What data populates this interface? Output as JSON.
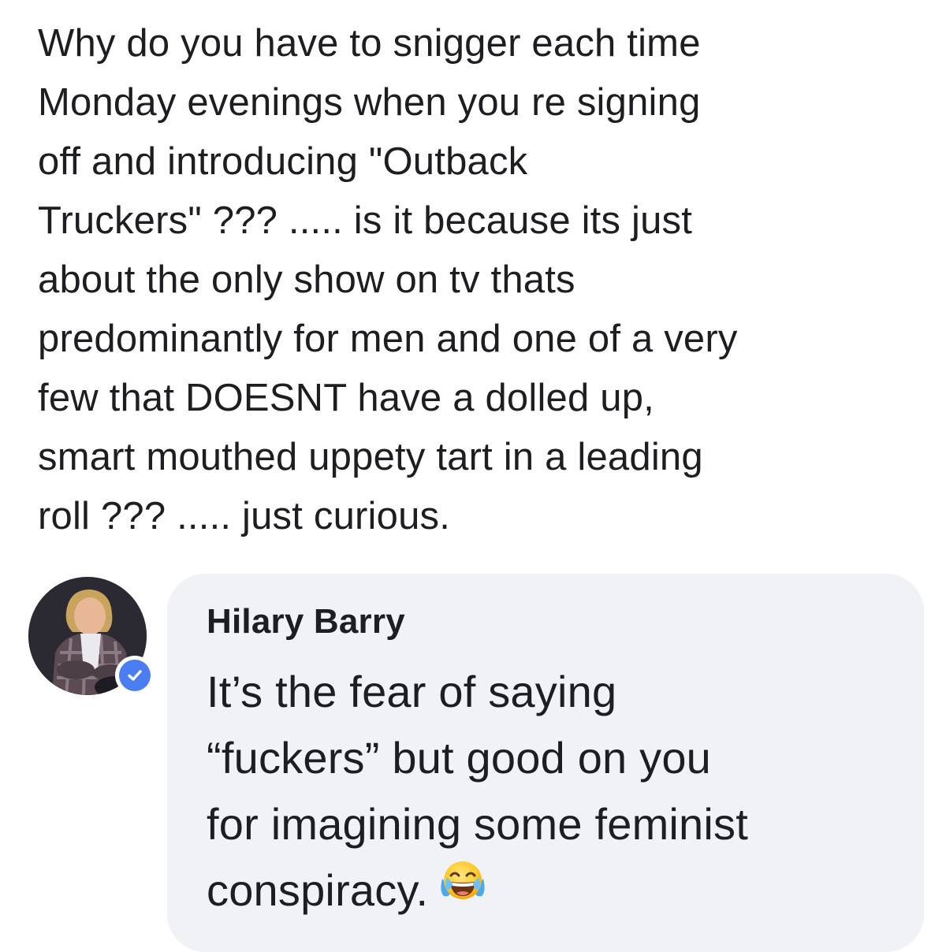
{
  "original_comment": {
    "lines": [
      "Why do you have to snigger each time",
      "Monday evenings when you re signing",
      "off and introducing \"Outback",
      "Truckers\" ??? ..... is it because its just",
      "about the only show on tv thats",
      "predominantly for men and one of a very",
      "few that DOESNT have a dolled up,",
      "smart mouthed uppety tart in a leading",
      "roll ??? ..... just curious."
    ]
  },
  "reply": {
    "author": "Hilary Barry",
    "verified": true,
    "lines": [
      "It’s the fear of saying",
      "“fuckers” but good on you",
      "for imagining some feminist",
      "conspiracy."
    ],
    "trailing_emoji": "face-with-tears-of-joy-icon"
  },
  "colors": {
    "text": "#1c1e21",
    "bubble_background": "#f0f2f5",
    "verified_blue": "#4a7cf2",
    "background": "#ffffff"
  }
}
